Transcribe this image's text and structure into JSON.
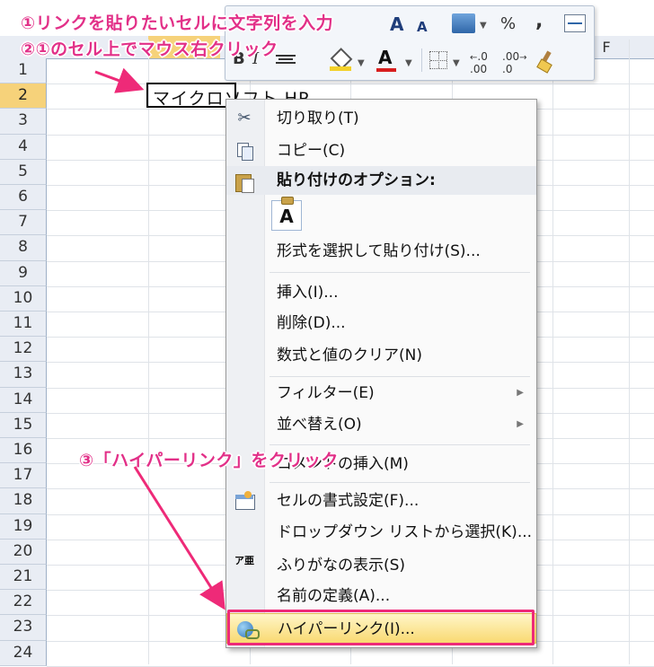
{
  "sheet": {
    "rows": [
      "1",
      "2",
      "3",
      "4",
      "5",
      "6",
      "7",
      "8",
      "9",
      "10",
      "11",
      "12",
      "13",
      "14",
      "15",
      "16",
      "17",
      "18",
      "19",
      "20",
      "21",
      "22",
      "23",
      "24"
    ],
    "selected_row": "2",
    "visible_column_header": "F",
    "active_cell_text": "マイクロソフト HP"
  },
  "mini_toolbar": {
    "grow_font": "A",
    "shrink_font": "A",
    "percent": "%",
    "comma": ",",
    "bold": "B",
    "italic": "I",
    "font_color": "A",
    "increase_decimal": ".00",
    "decrease_decimal": ".0"
  },
  "menu": {
    "items": [
      {
        "label": "切り取り(T)",
        "icon": "scissors-icon"
      },
      {
        "label": "コピー(C)",
        "icon": "copy-icon"
      },
      {
        "label": "貼り付けのオプション:",
        "icon": "paste-icon"
      },
      {
        "label": "形式を選択して貼り付け(S)..."
      },
      {
        "label": "挿入(I)..."
      },
      {
        "label": "削除(D)..."
      },
      {
        "label": "数式と値のクリア(N)"
      },
      {
        "label": "フィルター(E)",
        "submenu": "▶"
      },
      {
        "label": "並べ替え(O)",
        "submenu": "▶"
      },
      {
        "label": "コメントの挿入(M)"
      },
      {
        "label": "セルの書式設定(F)..."
      },
      {
        "label": "ドロップダウン リストから選択(K)..."
      },
      {
        "label": "ふりがなの表示(S)",
        "icon_text": "ア亜"
      },
      {
        "label": "名前の定義(A)..."
      },
      {
        "label": "ハイパーリンク(I)...",
        "icon": "hyperlink-icon"
      }
    ],
    "paste_option_letter": "A"
  },
  "annotations": {
    "step1": "①リンクを貼りたいセルに文字列を入力",
    "step2": "②①のセル上でマウス右クリック",
    "step3": "③「ハイパーリンク」をクリック"
  },
  "colors": {
    "annotation": "#e23088",
    "highlight_border": "#ee2a78",
    "hot_item": "#f9d971"
  }
}
